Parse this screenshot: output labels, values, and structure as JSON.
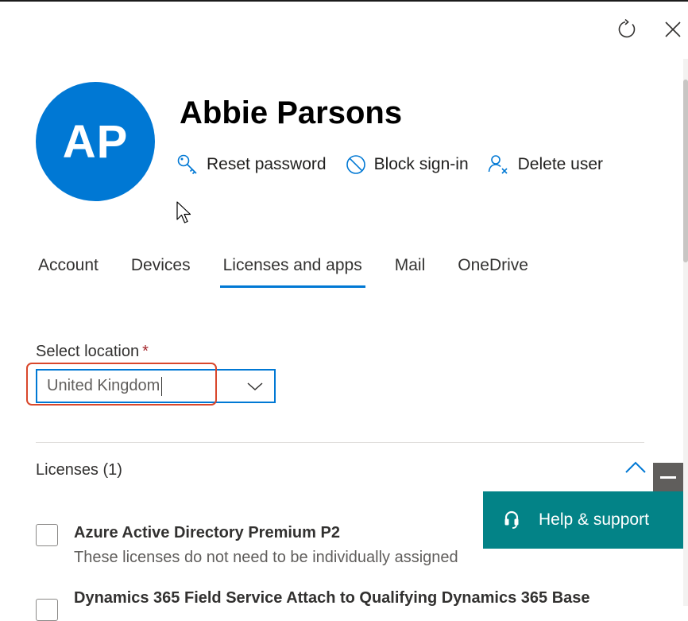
{
  "header": {
    "refresh_icon": "refresh-icon",
    "close_icon": "close-icon"
  },
  "user": {
    "initials": "AP",
    "name": "Abbie Parsons",
    "avatar_color": "#0078d4"
  },
  "actions": [
    {
      "icon": "key-icon",
      "label": "Reset password"
    },
    {
      "icon": "block-icon",
      "label": "Block sign-in"
    },
    {
      "icon": "delete-user-icon",
      "label": "Delete user"
    }
  ],
  "tabs": [
    {
      "label": "Account",
      "active": false
    },
    {
      "label": "Devices",
      "active": false
    },
    {
      "label": "Licenses and apps",
      "active": true
    },
    {
      "label": "Mail",
      "active": false
    },
    {
      "label": "OneDrive",
      "active": false
    }
  ],
  "location": {
    "label": "Select location",
    "required_mark": "*",
    "value": "United Kingdom"
  },
  "licenses": {
    "header": "Licenses (1)",
    "items": [
      {
        "name": "Azure Active Directory Premium P2",
        "description": "These licenses do not need to be individually assigned",
        "checked": false
      },
      {
        "name": "Dynamics 365 Field Service Attach to Qualifying Dynamics 365 Base",
        "checked": false
      }
    ]
  },
  "help": {
    "label": "Help & support",
    "icon": "headset-icon",
    "color": "#038387"
  },
  "colors": {
    "accent": "#0078d4",
    "highlight": "#d9472b",
    "required": "#a4262c"
  }
}
